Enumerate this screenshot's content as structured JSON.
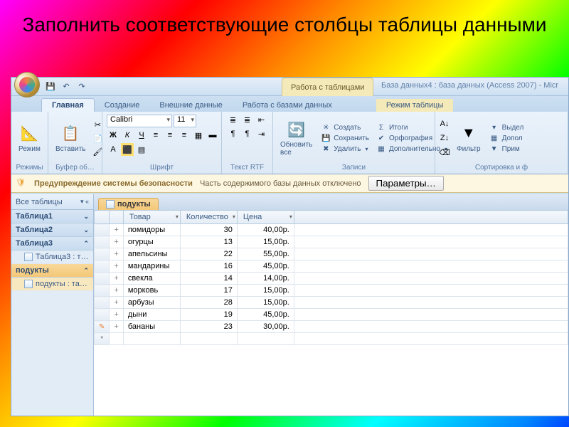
{
  "slide": {
    "title": "Заполнить соответствующие столбцы таблицы данными"
  },
  "titlebar": {
    "context_label": "Работа с таблицами",
    "app_title": "База данных4 : база данных (Access 2007) - Micr"
  },
  "tabs": {
    "home": "Главная",
    "create": "Создание",
    "external": "Внешние данные",
    "dbtools": "Работа с базами данных",
    "tablemode": "Режим таблицы"
  },
  "ribbon": {
    "views": {
      "label": "Режимы",
      "btn": "Режим"
    },
    "clipboard": {
      "label": "Буфер об…",
      "btn": "Вставить"
    },
    "font": {
      "label": "Шрифт",
      "name": "Calibri",
      "size": "11"
    },
    "rtf": {
      "label": "Текст RTF"
    },
    "records": {
      "label": "Записи",
      "refresh": "Обновить все",
      "new": "Создать",
      "save": "Сохранить",
      "delete": "Удалить",
      "totals": "Итоги",
      "spelling": "Орфография",
      "more": "Дополнительно"
    },
    "sortfilter": {
      "label": "Сортировка и ф",
      "filter": "Фильтр",
      "select": "Выдел",
      "advanced": "Допол",
      "toggle": "Прим"
    }
  },
  "security": {
    "title": "Предупреждение системы безопасности",
    "message": "Часть содержимого базы данных отключено",
    "button": "Параметры…"
  },
  "nav": {
    "header": "Все таблицы",
    "groups": [
      {
        "name": "Таблица1",
        "items": []
      },
      {
        "name": "Таблица2",
        "items": []
      },
      {
        "name": "Таблица3",
        "items": [
          "Таблица3 : т…"
        ]
      },
      {
        "name": "подукты",
        "items": [
          "подукты : та…"
        ]
      }
    ]
  },
  "doctab": {
    "name": "подукты"
  },
  "grid": {
    "columns": [
      "Товар",
      "Количество",
      "Цена"
    ],
    "rows": [
      {
        "product": "помидоры",
        "qty": 30,
        "price": "40,00p."
      },
      {
        "product": "огурцы",
        "qty": 13,
        "price": "15,00p."
      },
      {
        "product": "апельсины",
        "qty": 22,
        "price": "55,00p."
      },
      {
        "product": "мандарины",
        "qty": 16,
        "price": "45,00p."
      },
      {
        "product": "свекла",
        "qty": 14,
        "price": "14,00p."
      },
      {
        "product": "морковь",
        "qty": 17,
        "price": "15,00p."
      },
      {
        "product": "арбузы",
        "qty": 28,
        "price": "15,00p."
      },
      {
        "product": "дыни",
        "qty": 19,
        "price": "45,00p."
      },
      {
        "product": "бананы",
        "qty": 23,
        "price": "30,00p."
      }
    ]
  }
}
